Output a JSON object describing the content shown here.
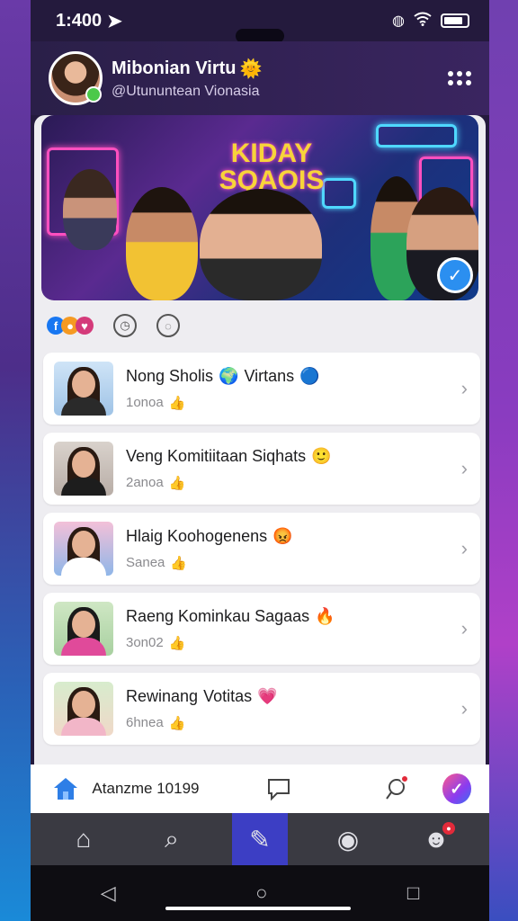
{
  "status_bar": {
    "time": "1:400",
    "colors": {
      "icons": "#ffffff"
    }
  },
  "profile": {
    "name": "Mibonian Virtu",
    "name_emoji": "🌞",
    "handle": "@Utununtean Vionasia"
  },
  "banner": {
    "title_line1": "KIDAY",
    "title_line2": "SQAOIS"
  },
  "reactions": {
    "icons": [
      "facebook-icon",
      "emoji-icon",
      "heart-icon"
    ],
    "actions": [
      "timer-icon",
      "chat-bubble-icon"
    ]
  },
  "list": [
    {
      "title": "Nong Sholis",
      "title_emoji": "🌍",
      "title_tail": "Virtans",
      "tail_emoji": "🔵",
      "sub": "1onoa"
    },
    {
      "title": "Veng Komitiitaan Siqhats",
      "title_emoji": "🙂",
      "title_tail": "",
      "tail_emoji": "",
      "sub": "2anoa"
    },
    {
      "title": "Hlaig Koohogenens",
      "title_emoji": "😡",
      "title_tail": "",
      "tail_emoji": "",
      "sub": "Sanea"
    },
    {
      "title": "Raeng Kominkau Sagaas",
      "title_emoji": "🔥",
      "title_tail": "",
      "tail_emoji": "",
      "sub": "3on02"
    },
    {
      "title": "Rewinang",
      "title_emoji": "",
      "title_tail": "Votitas",
      "tail_emoji": "💗",
      "sub": "6hnea"
    }
  ],
  "compose": {
    "label": "Atanzme 10199"
  },
  "tabs": [
    {
      "name": "home",
      "icon": "⌂"
    },
    {
      "name": "search",
      "icon": "⌕"
    },
    {
      "name": "compose",
      "icon": "✎"
    },
    {
      "name": "explore",
      "icon": "◉"
    },
    {
      "name": "profile",
      "icon": "☻"
    }
  ],
  "colors": {
    "accent": "#3c3ec4",
    "badge": "#e22a3a",
    "link_blue": "#2e7ee6"
  }
}
